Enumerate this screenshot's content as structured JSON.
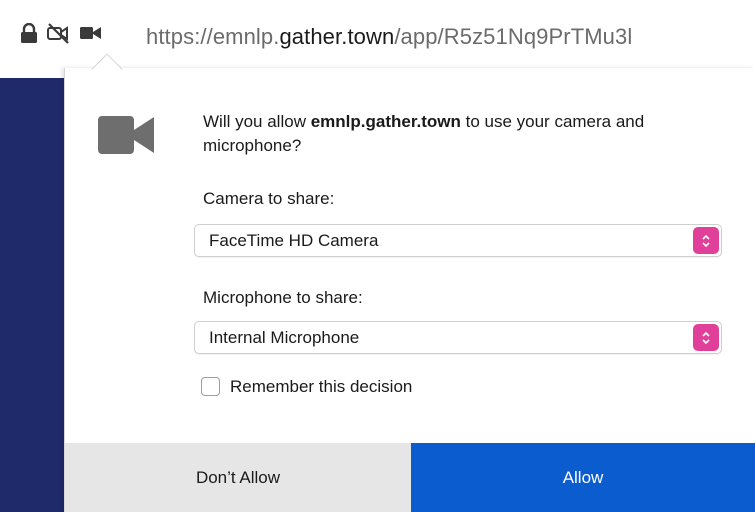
{
  "urlbar": {
    "url_prefix": "https://emnlp.",
    "url_host": "gather.town",
    "url_suffix": "/app/R5z51Nq9PrTMu3l",
    "icons": [
      "lock-icon",
      "camera-blocked-icon",
      "camera-icon"
    ]
  },
  "dialog": {
    "prompt_before": "Will you allow ",
    "prompt_site": "emnlp.gather.town",
    "prompt_after": " to use your camera and microphone?",
    "camera_label": "Camera to share:",
    "camera_selected": "FaceTime HD Camera",
    "microphone_label": "Microphone to share:",
    "microphone_selected": "Internal Microphone",
    "remember_label": "Remember this decision",
    "remember_checked": false,
    "deny_label": "Don’t Allow",
    "allow_label": "Allow",
    "big_icon": "camera-icon"
  },
  "colors": {
    "page_background": "#1f2a6b",
    "allow_button": "#0a5ccf",
    "deny_button": "#e6e6e6",
    "stepper_accent": "#e0409a",
    "icon_gray": "#6e6e6e"
  }
}
